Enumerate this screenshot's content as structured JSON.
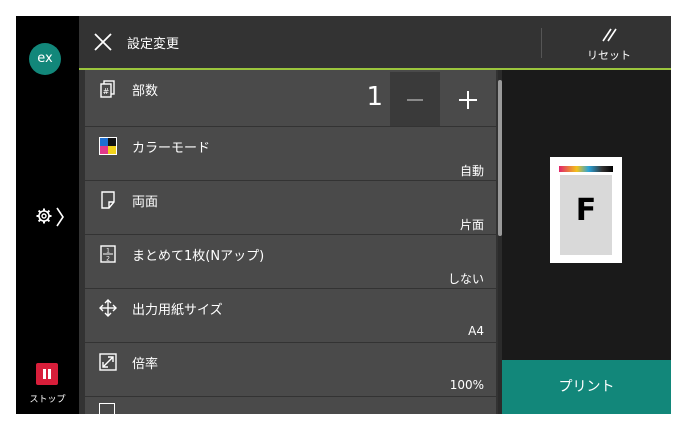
{
  "left_rail": {
    "badge": "ex",
    "stop_label": "ストップ"
  },
  "header": {
    "title": "設定変更",
    "reset_label": "リセット"
  },
  "settings": [
    {
      "label": "部数",
      "value": "1",
      "icon": "copies-icon"
    },
    {
      "label": "カラーモード",
      "value": "自動",
      "icon": "color-mode-icon"
    },
    {
      "label": "両面",
      "value": "片面",
      "icon": "duplex-icon"
    },
    {
      "label": "まとめて1枚(Nアップ)",
      "value": "しない",
      "icon": "n-up-icon"
    },
    {
      "label": "出力用紙サイズ",
      "value": "A4",
      "icon": "paper-size-icon"
    },
    {
      "label": "倍率",
      "value": "100%",
      "icon": "zoom-ratio-icon"
    }
  ],
  "preview": {
    "letter": "F"
  },
  "print_label": "プリント",
  "colors": {
    "accent_teal": "#12877a",
    "header_underline": "#9bc53d",
    "stop_red": "#d81e3a"
  }
}
